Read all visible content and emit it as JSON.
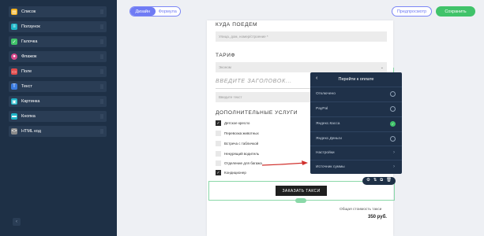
{
  "sidebar": {
    "items": [
      {
        "label": "Список",
        "icon": "list-icon",
        "color": "#f2b01e"
      },
      {
        "label": "Ползунок",
        "icon": "slider-icon",
        "color": "#1fb5c7"
      },
      {
        "label": "Галочка",
        "icon": "checkbox-icon",
        "color": "#40c36a"
      },
      {
        "label": "Флажок",
        "icon": "radio-icon",
        "color": "#d94a8c"
      },
      {
        "label": "Поле",
        "icon": "field-icon",
        "color": "#e24b4b"
      },
      {
        "label": "Текст",
        "icon": "text-icon",
        "color": "#3b7be0"
      },
      {
        "label": "Картинка",
        "icon": "image-icon",
        "color": "#1fb5c7"
      },
      {
        "label": "Кнопка",
        "icon": "button-icon",
        "color": "#1fb5c7"
      },
      {
        "label": "HTML код",
        "icon": "code-icon",
        "color": "#8a8a8a"
      }
    ],
    "collapse_glyph": "‹"
  },
  "topbar": {
    "tab_design": "Дизайн",
    "tab_formula": "Формула",
    "preview_label": "Предпросмотр",
    "save_label": "Сохранить"
  },
  "form": {
    "where_title": "КУДА ПОЕДЕМ",
    "where_placeholder": "Улица, дом, номер/строение *",
    "tariff_title": "ТАРИФ",
    "tariff_value": "Эконом",
    "heading_placeholder": "ВВЕДИТЕ ЗАГОЛОВОК...",
    "text_placeholder": "Введите текст",
    "services_title": "ДОПОЛНИТЕЛЬНЫЕ УСЛУГИ",
    "services": [
      {
        "label": "Детское кресло",
        "checked": true
      },
      {
        "label": "Перевозка животных",
        "checked": false
      },
      {
        "label": "Встреча с табличкой",
        "checked": false
      },
      {
        "label": "Некурящий водитель",
        "checked": false
      },
      {
        "label": "Отделение для багажа",
        "checked": false
      },
      {
        "label": "Кондиционер",
        "checked": true
      }
    ],
    "order_button": "ЗАКАЗАТЬ ТАКСИ",
    "total_label": "Общая стоимость такси",
    "total_value": "350 руб."
  },
  "payment_panel": {
    "back_glyph": "‹",
    "title": "Перейти к оплате",
    "options": [
      {
        "label": "Отключено",
        "type": "radio",
        "selected": false
      },
      {
        "label": "PayPal",
        "type": "radio",
        "selected": false
      },
      {
        "label": "Яндекс.Касса",
        "type": "radio",
        "selected": true
      },
      {
        "label": "Яндекс.Деньги",
        "type": "radio",
        "selected": false
      },
      {
        "label": "Настройки",
        "type": "link"
      },
      {
        "label": "Источник суммы",
        "type": "link"
      }
    ]
  },
  "colors": {
    "sidebar_bg": "#1e3046",
    "accent": "#6f7bf4",
    "save_green": "#40c36a",
    "annotation_arrow": "#d0312d"
  }
}
